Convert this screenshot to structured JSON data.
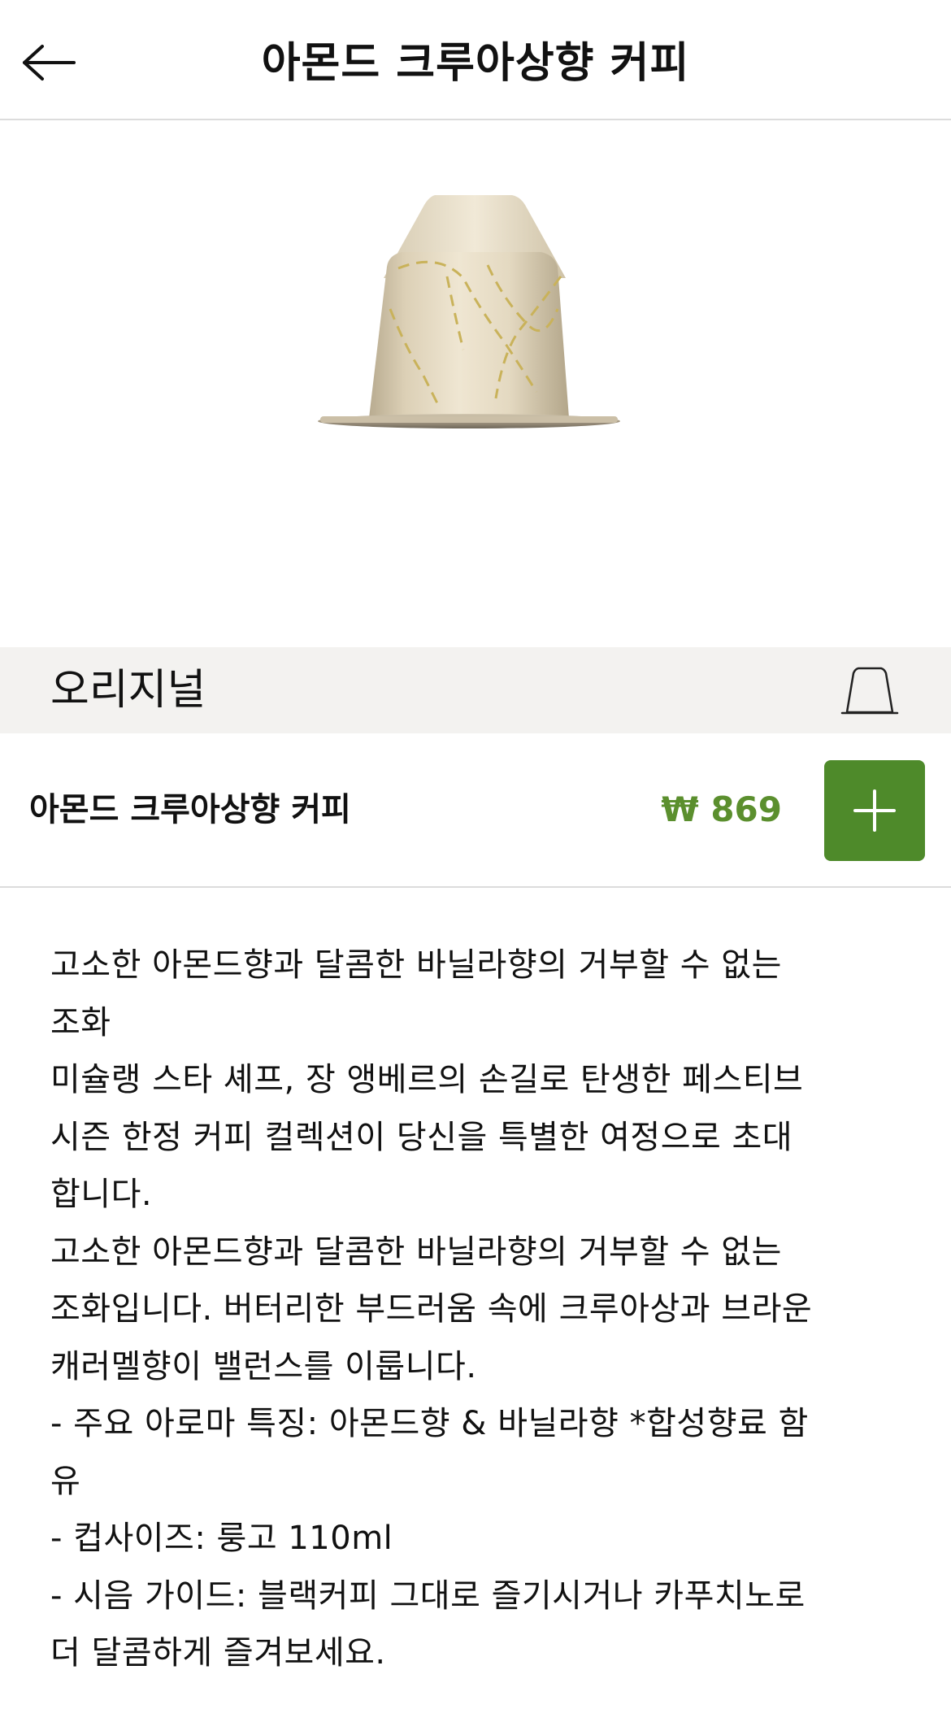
{
  "header": {
    "title": "아몬드 크루아상향 커피",
    "back_icon": "arrow-left-icon"
  },
  "hero": {
    "image": "coffee-capsule-image",
    "capsule_color": "#e3d8c0",
    "accent_color": "#c9b25a"
  },
  "category": {
    "label": "오리지널",
    "icon": "capsule-outline-icon",
    "background": "#f3f2f0"
  },
  "product": {
    "name": "아몬드 크루아상향 커피",
    "price": "₩ 869",
    "price_color": "#5b8f2e",
    "add_icon": "plus-icon",
    "add_button_color": "#4e8a2a"
  },
  "description": {
    "lines": [
      "고소한 아몬드향과 달콤한 바닐라향의 거부할 수 없는",
      "조화",
      "미슐랭 스타 셰프, 장 앵베르의 손길로 탄생한 페스티브",
      "시즌 한정 커피 컬렉션이 당신을 특별한 여정으로 초대",
      "합니다.",
      "고소한 아몬드향과 달콤한 바닐라향의 거부할 수 없는",
      "조화입니다. 버터리한 부드러움 속에 크루아상과 브라운",
      "캐러멜향이 밸런스를 이룹니다.",
      "- 주요 아로마 특징: 아몬드향 & 바닐라향 *합성향료 함",
      "유",
      "- 컵사이즈: 룽고 110ml",
      "- 시음 가이드: 블랙커피 그대로 즐기시거나 카푸치노로",
      "더 달콤하게 즐겨보세요."
    ]
  }
}
